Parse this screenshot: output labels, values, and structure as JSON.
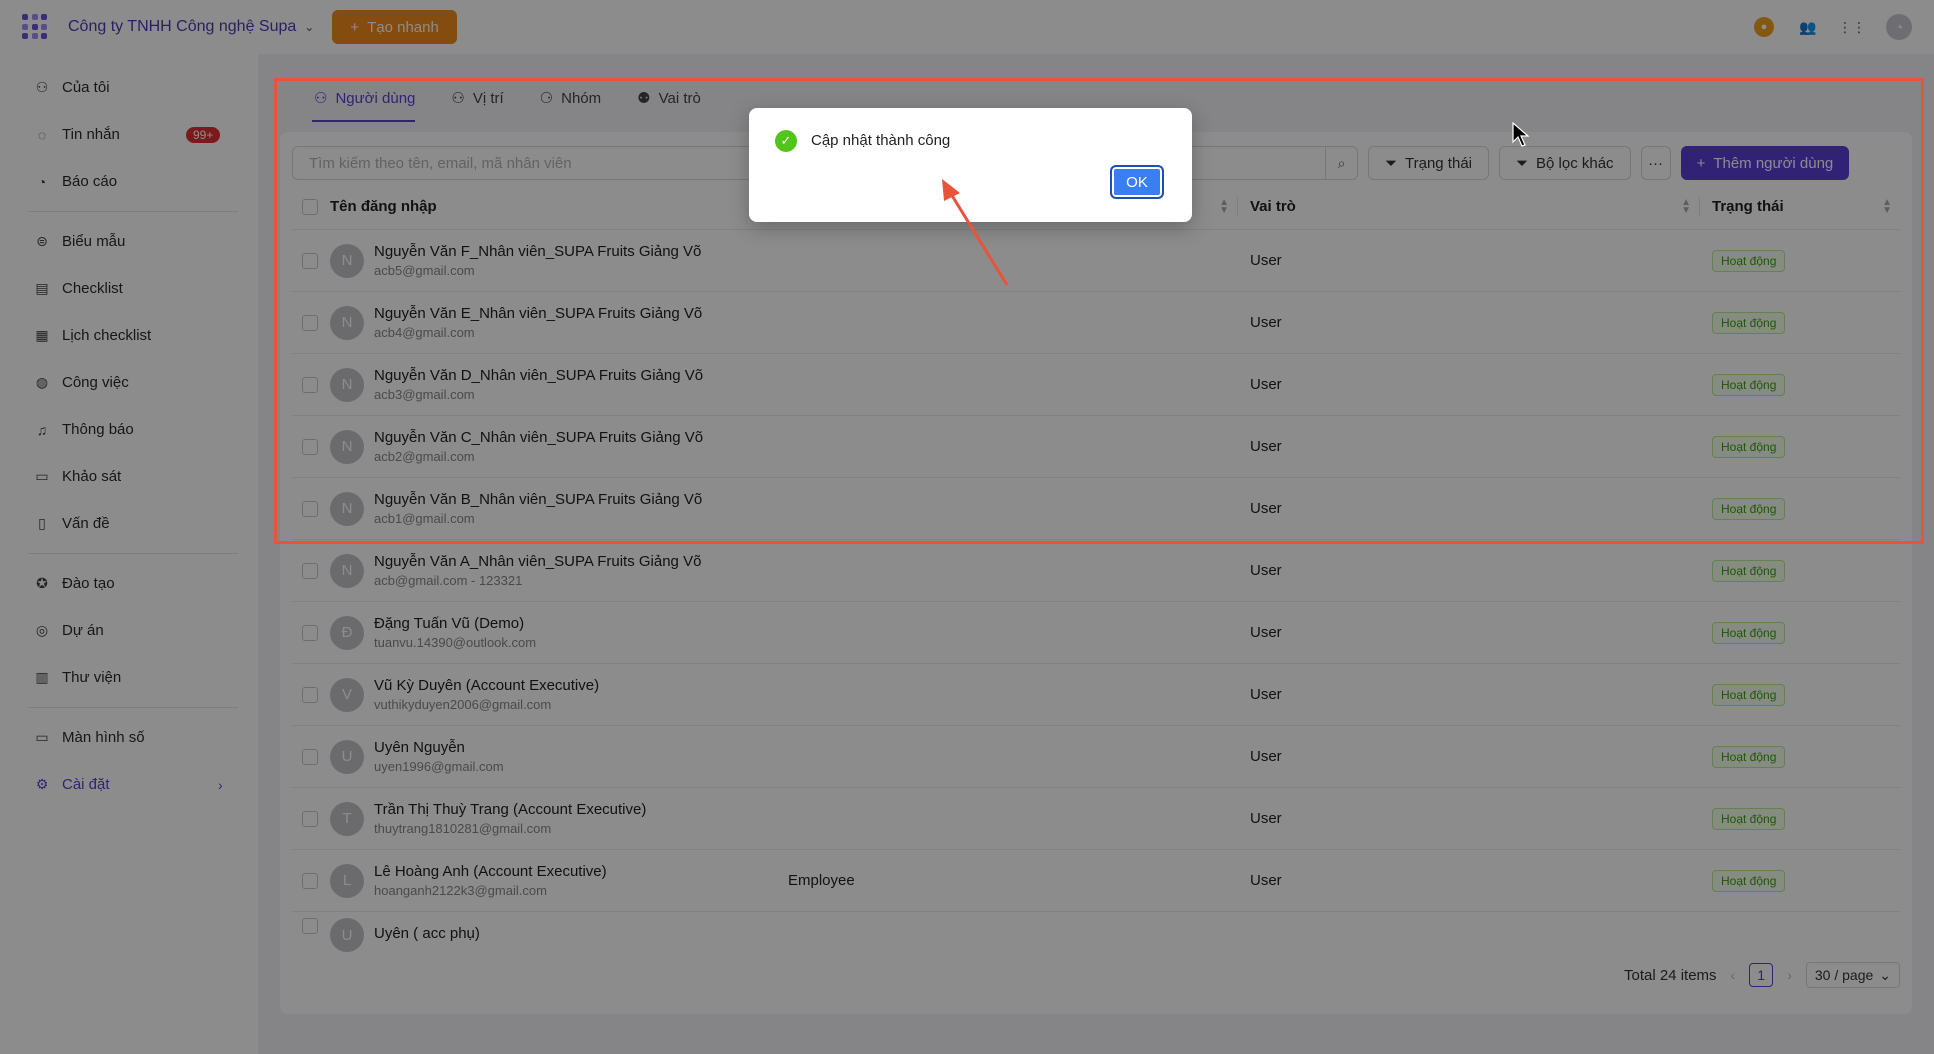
{
  "topbar": {
    "company": "Công ty TNHH Công nghệ Supa",
    "quick_create": "Tạo nhanh"
  },
  "sidebar": {
    "items": [
      {
        "label": "Của tôi",
        "icon": "user-icon"
      },
      {
        "label": "Tin nhắn",
        "icon": "chat-icon",
        "badge": "99+"
      },
      {
        "label": "Báo cáo",
        "icon": "report-icon"
      },
      {
        "label": "Biểu mẫu",
        "icon": "form-icon"
      },
      {
        "label": "Checklist",
        "icon": "checklist-icon"
      },
      {
        "label": "Lịch checklist",
        "icon": "calendar-icon"
      },
      {
        "label": "Công việc",
        "icon": "task-icon"
      },
      {
        "label": "Thông báo",
        "icon": "bell-icon"
      },
      {
        "label": "Khảo sát",
        "icon": "survey-icon"
      },
      {
        "label": "Vấn đề",
        "icon": "issue-icon"
      },
      {
        "label": "Đào tạo",
        "icon": "training-icon"
      },
      {
        "label": "Dự án",
        "icon": "project-icon"
      },
      {
        "label": "Thư viện",
        "icon": "library-icon"
      },
      {
        "label": "Màn hình số",
        "icon": "monitor-icon"
      },
      {
        "label": "Cài đặt",
        "icon": "gear-icon"
      }
    ]
  },
  "tabs": [
    {
      "label": "Người dùng",
      "icon": "users-icon"
    },
    {
      "label": "Vị trí",
      "icon": "position-icon"
    },
    {
      "label": "Nhóm",
      "icon": "group-icon"
    },
    {
      "label": "Vai trò",
      "icon": "role-icon"
    }
  ],
  "toolbar": {
    "search_placeholder": "Tìm kiếm theo tên, email, mã nhân viên",
    "status_filter": "Trạng thái",
    "other_filter": "Bộ lọc khác",
    "more": "···",
    "add_user": "Thêm người dùng"
  },
  "table": {
    "headers": {
      "name": "Tên đăng nhập",
      "role": "Vai trò",
      "status": "Trạng thái"
    },
    "rows": [
      {
        "initial": "N",
        "name": "Nguyễn Văn F_Nhân viên_SUPA Fruits Giảng Võ",
        "email": "acb5@gmail.com",
        "position": "",
        "role": "User",
        "status": "Hoạt động"
      },
      {
        "initial": "N",
        "name": "Nguyễn Văn E_Nhân viên_SUPA Fruits Giảng Võ",
        "email": "acb4@gmail.com",
        "position": "",
        "role": "User",
        "status": "Hoạt động"
      },
      {
        "initial": "N",
        "name": "Nguyễn Văn D_Nhân viên_SUPA Fruits Giảng Võ",
        "email": "acb3@gmail.com",
        "position": "",
        "role": "User",
        "status": "Hoạt động"
      },
      {
        "initial": "N",
        "name": "Nguyễn Văn C_Nhân viên_SUPA Fruits Giảng Võ",
        "email": "acb2@gmail.com",
        "position": "",
        "role": "User",
        "status": "Hoạt động"
      },
      {
        "initial": "N",
        "name": "Nguyễn Văn B_Nhân viên_SUPA Fruits Giảng Võ",
        "email": "acb1@gmail.com",
        "position": "",
        "role": "User",
        "status": "Hoạt động"
      },
      {
        "initial": "N",
        "name": "Nguyễn Văn A_Nhân viên_SUPA Fruits Giảng Võ",
        "email": "acb@gmail.com - 123321",
        "position": "",
        "role": "User",
        "status": "Hoạt động"
      },
      {
        "initial": "Đ",
        "name": "Đặng Tuấn Vũ (Demo)",
        "email": "tuanvu.14390@outlook.com",
        "position": "",
        "role": "User",
        "status": "Hoạt động"
      },
      {
        "initial": "V",
        "name": "Vũ Kỳ Duyên (Account Executive)",
        "email": "vuthikyduyen2006@gmail.com",
        "position": "",
        "role": "User",
        "status": "Hoạt động"
      },
      {
        "initial": "U",
        "name": "Uyên Nguyễn",
        "email": "uyen1996@gmail.com",
        "position": "",
        "role": "User",
        "status": "Hoạt động"
      },
      {
        "initial": "T",
        "name": "Trần Thị Thuỳ Trang (Account Executive)",
        "email": "thuytrang1810281@gmail.com",
        "position": "",
        "role": "User",
        "status": "Hoạt động"
      },
      {
        "initial": "L",
        "name": "Lê Hoàng Anh (Account Executive)",
        "email": "hoanganh2122k3@gmail.com",
        "position": "Employee",
        "role": "User",
        "status": "Hoạt động"
      },
      {
        "initial": "U",
        "name": "Uyên ( acc phụ)",
        "email": "",
        "position": "",
        "role": "",
        "status": ""
      }
    ]
  },
  "pagination": {
    "total": "Total 24 items",
    "current_page": "1",
    "page_size": "30 / page"
  },
  "modal": {
    "message": "Cập nhật thành công",
    "ok": "OK"
  },
  "colors": {
    "primary": "#5b3fd6",
    "accent_orange": "#f08a1d",
    "success": "#52c41a",
    "annotation_red": "#e8533a",
    "ok_blue": "#3a7ff0"
  }
}
